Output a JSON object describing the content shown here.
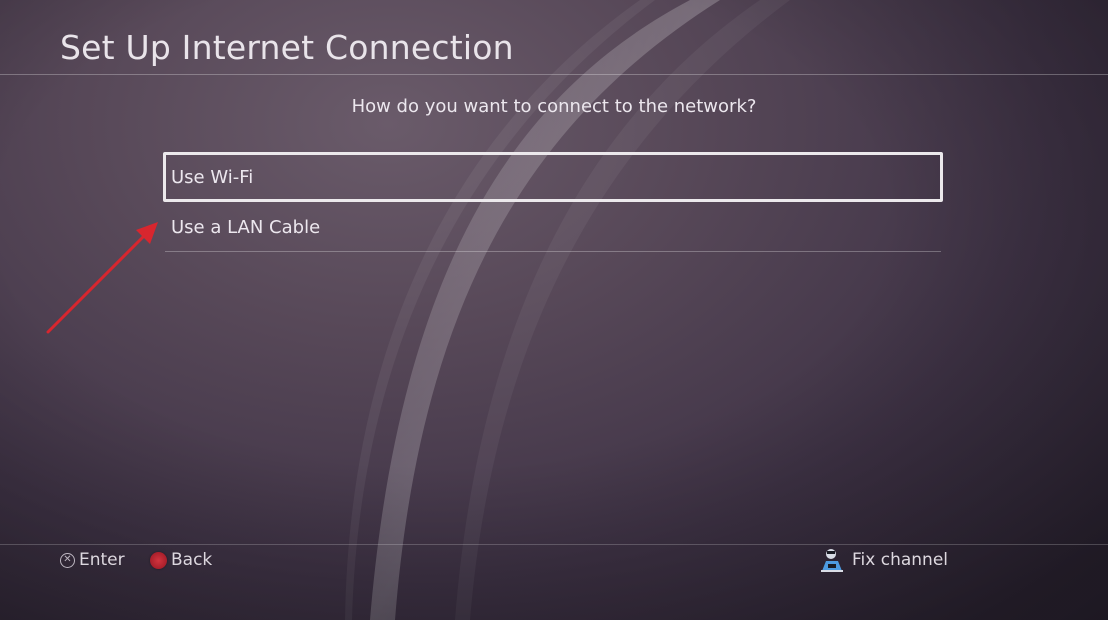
{
  "screen": {
    "title": "Set Up Internet Connection",
    "question": "How do you want to connect to the network?"
  },
  "options": [
    {
      "label": "Use Wi-Fi",
      "selected": true
    },
    {
      "label": "Use a LAN Cable",
      "selected": false
    }
  ],
  "footer": {
    "enter_label": "Enter",
    "back_label": "Back",
    "fix_label": "Fix channel"
  },
  "icons": {
    "enter": "cross-button-icon",
    "back": "circle-button-icon",
    "fix": "fix-channel-icon",
    "annotation": "red-arrow-icon"
  },
  "colors": {
    "accent_red": "#d8262e",
    "background": "#4a3c4e",
    "text": "#ece7ee"
  }
}
